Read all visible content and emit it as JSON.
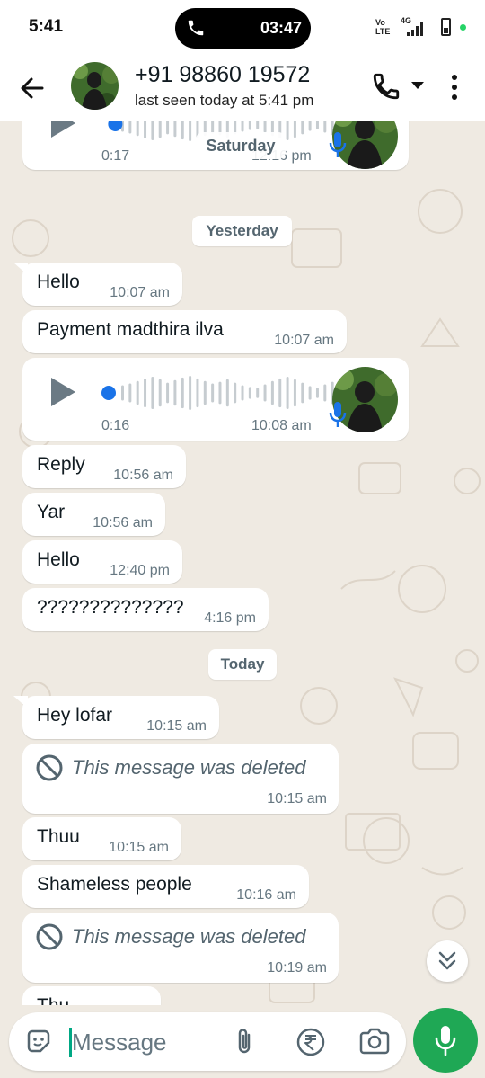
{
  "status_bar": {
    "time": "5:41",
    "call_duration": "03:47",
    "volte_line1": "Vo",
    "volte_line2": "LTE",
    "network": "4G"
  },
  "header": {
    "contact_name": "+91 98860 19572",
    "last_seen": "last seen today at 5:41 pm"
  },
  "chat": {
    "floating_date": "Saturday",
    "voice_1": {
      "duration": "0:17",
      "time": "12:16 pm",
      "progress": 0.03
    },
    "date_yesterday": "Yesterday",
    "msg_hello_1": {
      "text": "Hello",
      "time": "10:07 am"
    },
    "msg_payment": {
      "text": "Payment madthira ilva",
      "time": "10:07 am"
    },
    "voice_2": {
      "duration": "0:16",
      "time": "10:08 am",
      "progress": 0.0
    },
    "msg_reply": {
      "text": "Reply",
      "time": "10:56 am"
    },
    "msg_yar": {
      "text": "Yar",
      "time": "10:56 am"
    },
    "msg_hello_2": {
      "text": "Hello",
      "time": "12:40 pm"
    },
    "msg_question": {
      "text": "??????????????",
      "time": "4:16 pm"
    },
    "date_today": "Today",
    "msg_hey": {
      "text": "Hey lofar",
      "time": "10:15 am"
    },
    "deleted_1": {
      "text": "This message was deleted",
      "time": "10:15 am"
    },
    "msg_thuu": {
      "text": "Thuu",
      "time": "10:15 am"
    },
    "msg_shameless": {
      "text": "Shameless people",
      "time": "10:16 am"
    },
    "deleted_2": {
      "text": "This message was deleted",
      "time": "10:19 am"
    },
    "msg_partial": {
      "text": "Thu"
    }
  },
  "composer": {
    "placeholder": "Message"
  },
  "colors": {
    "accent_green": "#1fa855",
    "chat_background": "#efeae2",
    "voice_dot": "#1a73e8",
    "timestamp_grey": "#667781"
  },
  "icons": [
    "back-arrow-icon",
    "phone-icon",
    "dropdown-caret-icon",
    "more-vert-icon",
    "play-icon",
    "mic-icon",
    "ban-icon",
    "double-chevron-down-icon",
    "sticker-emoji-icon",
    "paperclip-icon",
    "rupee-icon",
    "camera-icon"
  ]
}
